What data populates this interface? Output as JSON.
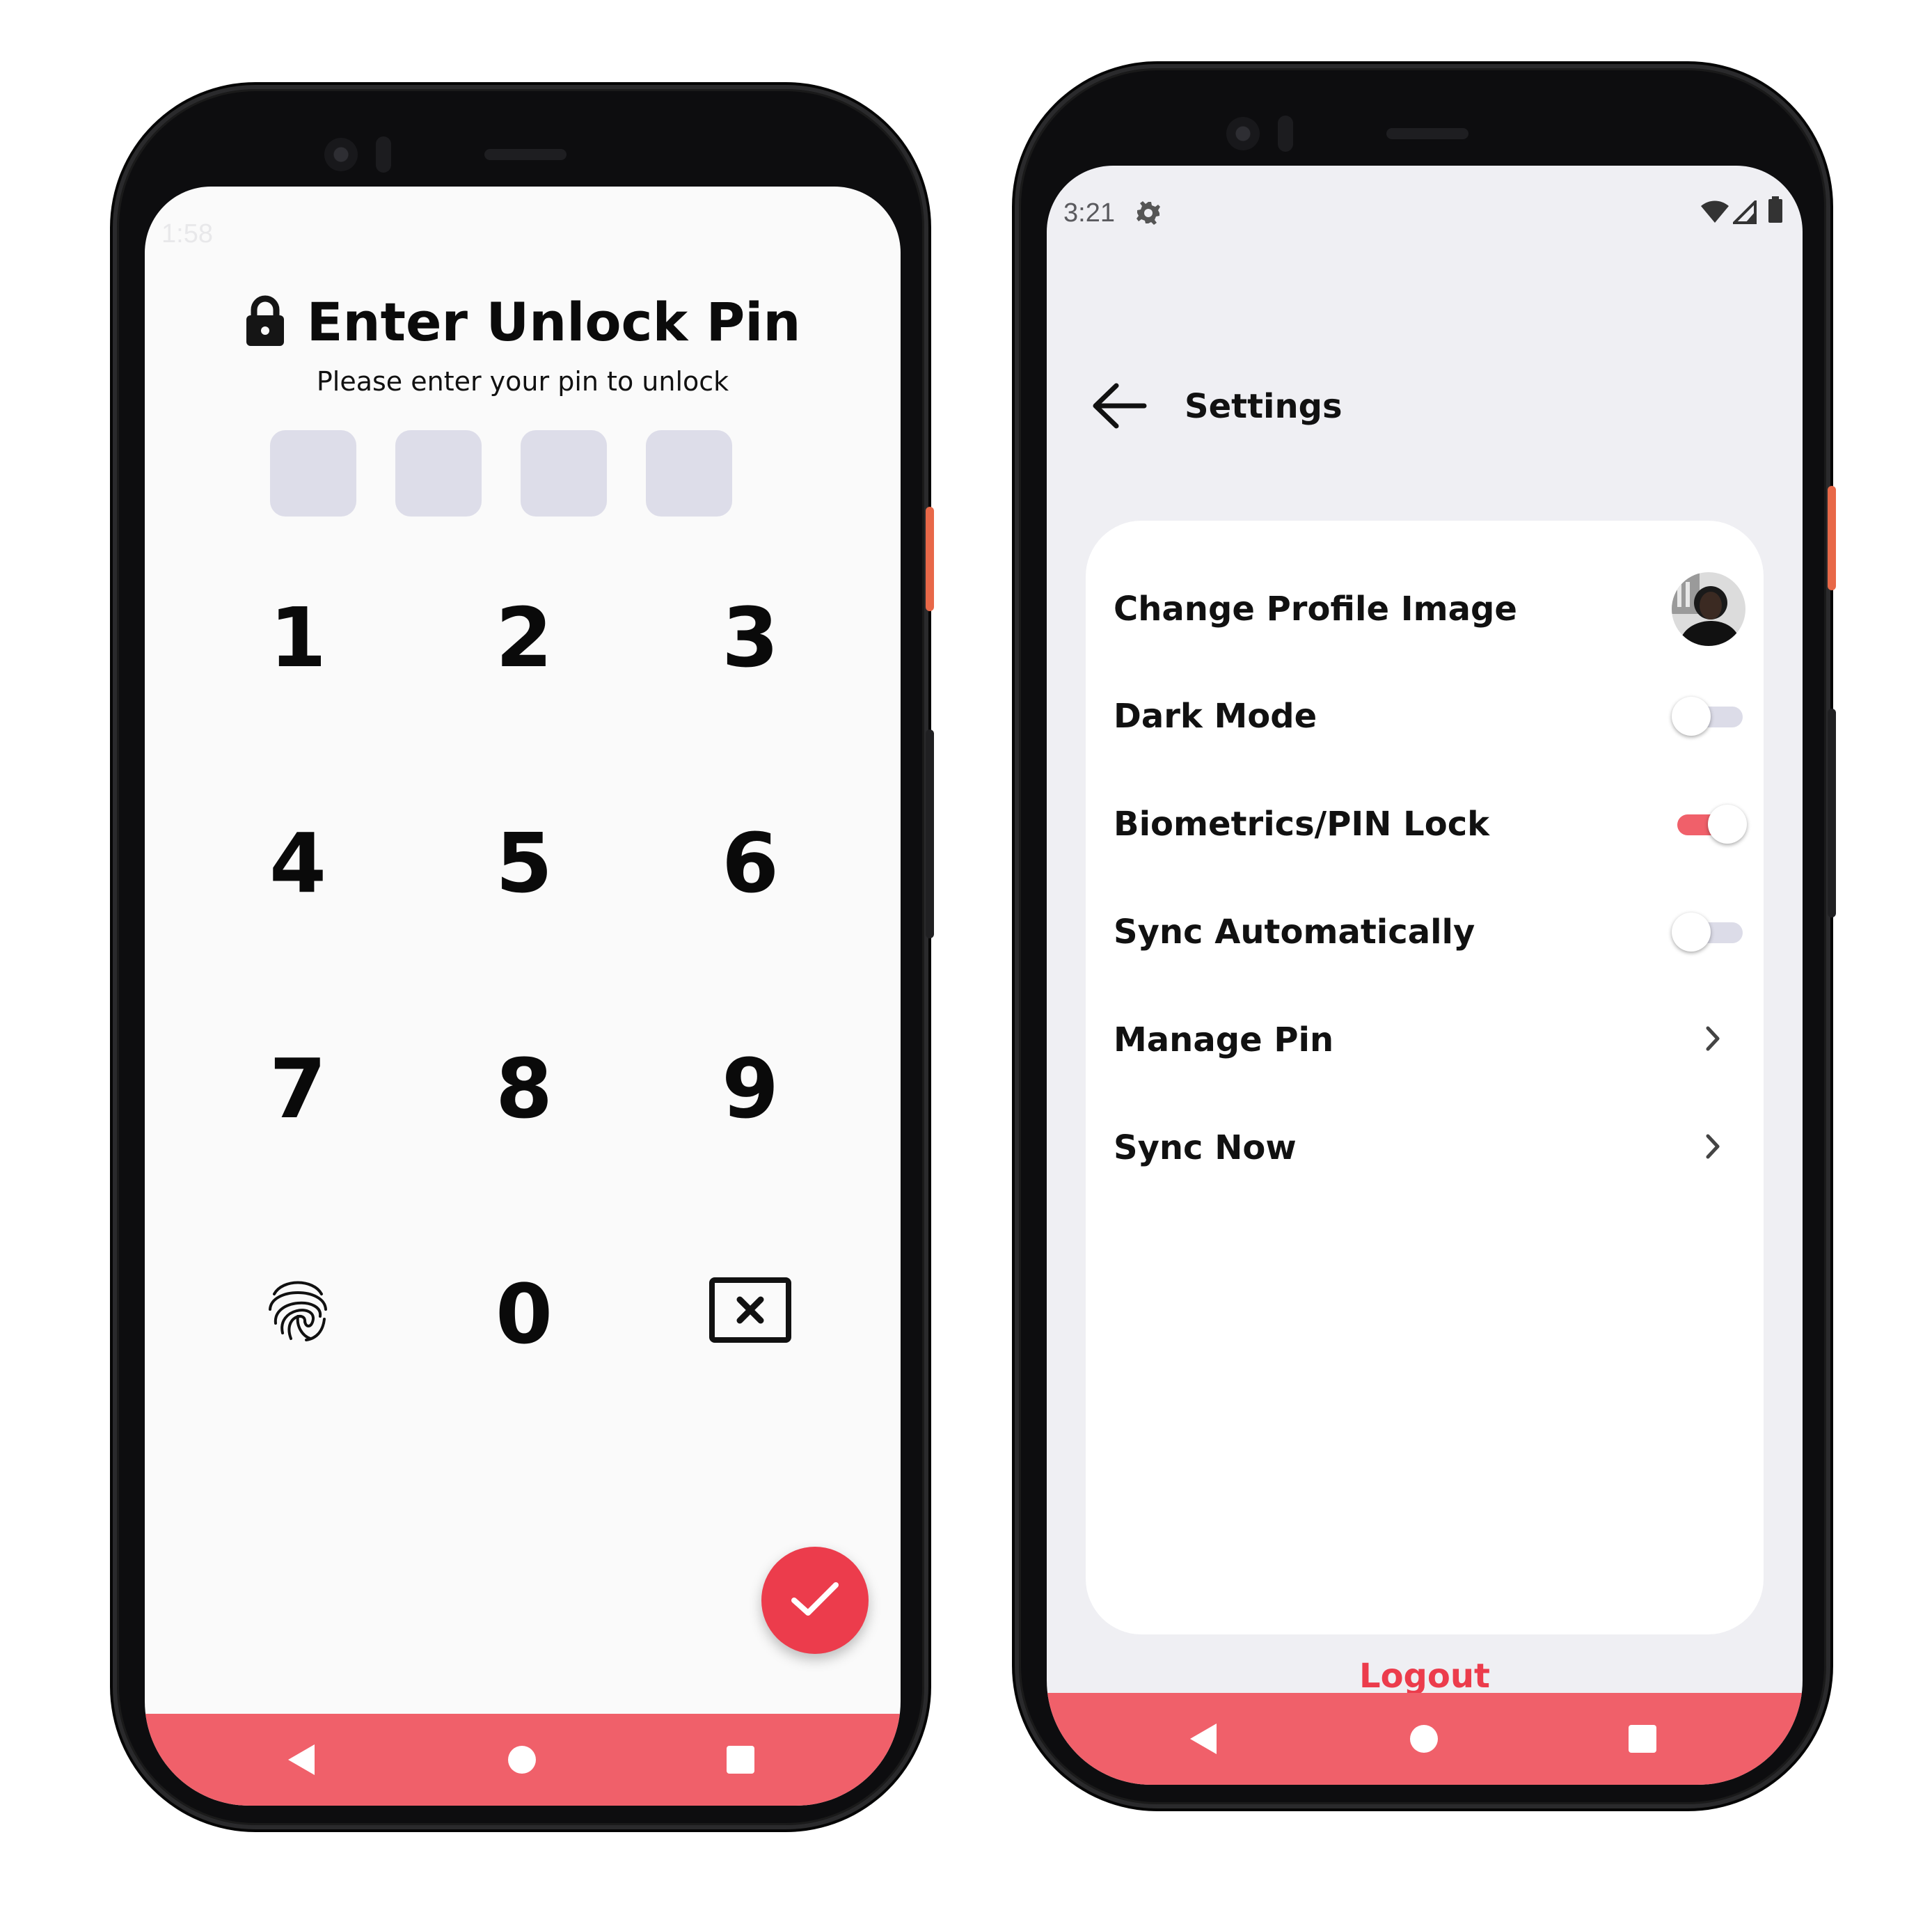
{
  "colors": {
    "accent": "#ec3c4c",
    "navbar": "#f0606a",
    "pin_box": "#dddde9",
    "toggle_off_track": "#dcdce8",
    "screen2_bg": "#efeff3"
  },
  "unlock_screen": {
    "status_time": "1:58",
    "title": "Enter Unlock Pin",
    "title_icon": "lock-icon",
    "subtitle": "Please enter your pin to unlock",
    "pin_length": 4,
    "keys": [
      "1",
      "2",
      "3",
      "4",
      "5",
      "6",
      "7",
      "8",
      "9",
      "0"
    ],
    "special_keys": [
      "fingerprint-icon",
      "backspace-icon"
    ],
    "fab_icon": "check-icon"
  },
  "settings_screen": {
    "status_time": "3:21",
    "header": {
      "title": "Settings",
      "back_icon": "arrow-left-icon"
    },
    "rows": [
      {
        "label": "Change Profile Image",
        "control": "avatar"
      },
      {
        "label": "Dark Mode",
        "control": "toggle",
        "on": false
      },
      {
        "label": "Biometrics/PIN Lock",
        "control": "toggle",
        "on": true
      },
      {
        "label": "Sync Automatically",
        "control": "toggle",
        "on": false
      },
      {
        "label": "Manage Pin",
        "control": "chevron"
      },
      {
        "label": "Sync Now",
        "control": "chevron"
      }
    ],
    "logout_label": "Logout"
  },
  "navbar": {
    "icons": [
      "back-triangle-icon",
      "home-circle-icon",
      "recents-square-icon"
    ]
  }
}
